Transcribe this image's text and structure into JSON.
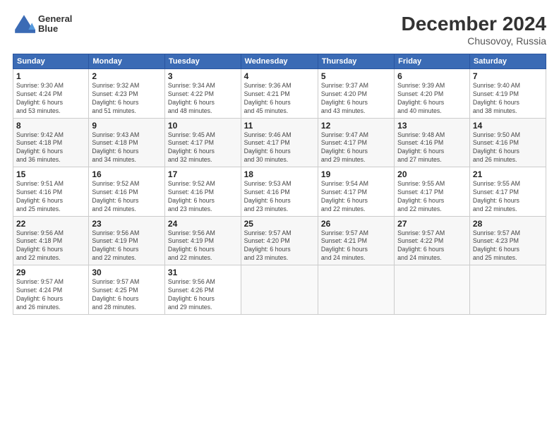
{
  "header": {
    "logo_line1": "General",
    "logo_line2": "Blue",
    "month_title": "December 2024",
    "location": "Chusovoy, Russia"
  },
  "weekdays": [
    "Sunday",
    "Monday",
    "Tuesday",
    "Wednesday",
    "Thursday",
    "Friday",
    "Saturday"
  ],
  "weeks": [
    [
      {
        "day": "1",
        "info": "Sunrise: 9:30 AM\nSunset: 4:24 PM\nDaylight: 6 hours\nand 53 minutes."
      },
      {
        "day": "2",
        "info": "Sunrise: 9:32 AM\nSunset: 4:23 PM\nDaylight: 6 hours\nand 51 minutes."
      },
      {
        "day": "3",
        "info": "Sunrise: 9:34 AM\nSunset: 4:22 PM\nDaylight: 6 hours\nand 48 minutes."
      },
      {
        "day": "4",
        "info": "Sunrise: 9:36 AM\nSunset: 4:21 PM\nDaylight: 6 hours\nand 45 minutes."
      },
      {
        "day": "5",
        "info": "Sunrise: 9:37 AM\nSunset: 4:20 PM\nDaylight: 6 hours\nand 43 minutes."
      },
      {
        "day": "6",
        "info": "Sunrise: 9:39 AM\nSunset: 4:20 PM\nDaylight: 6 hours\nand 40 minutes."
      },
      {
        "day": "7",
        "info": "Sunrise: 9:40 AM\nSunset: 4:19 PM\nDaylight: 6 hours\nand 38 minutes."
      }
    ],
    [
      {
        "day": "8",
        "info": "Sunrise: 9:42 AM\nSunset: 4:18 PM\nDaylight: 6 hours\nand 36 minutes."
      },
      {
        "day": "9",
        "info": "Sunrise: 9:43 AM\nSunset: 4:18 PM\nDaylight: 6 hours\nand 34 minutes."
      },
      {
        "day": "10",
        "info": "Sunrise: 9:45 AM\nSunset: 4:17 PM\nDaylight: 6 hours\nand 32 minutes."
      },
      {
        "day": "11",
        "info": "Sunrise: 9:46 AM\nSunset: 4:17 PM\nDaylight: 6 hours\nand 30 minutes."
      },
      {
        "day": "12",
        "info": "Sunrise: 9:47 AM\nSunset: 4:17 PM\nDaylight: 6 hours\nand 29 minutes."
      },
      {
        "day": "13",
        "info": "Sunrise: 9:48 AM\nSunset: 4:16 PM\nDaylight: 6 hours\nand 27 minutes."
      },
      {
        "day": "14",
        "info": "Sunrise: 9:50 AM\nSunset: 4:16 PM\nDaylight: 6 hours\nand 26 minutes."
      }
    ],
    [
      {
        "day": "15",
        "info": "Sunrise: 9:51 AM\nSunset: 4:16 PM\nDaylight: 6 hours\nand 25 minutes."
      },
      {
        "day": "16",
        "info": "Sunrise: 9:52 AM\nSunset: 4:16 PM\nDaylight: 6 hours\nand 24 minutes."
      },
      {
        "day": "17",
        "info": "Sunrise: 9:52 AM\nSunset: 4:16 PM\nDaylight: 6 hours\nand 23 minutes."
      },
      {
        "day": "18",
        "info": "Sunrise: 9:53 AM\nSunset: 4:16 PM\nDaylight: 6 hours\nand 23 minutes."
      },
      {
        "day": "19",
        "info": "Sunrise: 9:54 AM\nSunset: 4:17 PM\nDaylight: 6 hours\nand 22 minutes."
      },
      {
        "day": "20",
        "info": "Sunrise: 9:55 AM\nSunset: 4:17 PM\nDaylight: 6 hours\nand 22 minutes."
      },
      {
        "day": "21",
        "info": "Sunrise: 9:55 AM\nSunset: 4:17 PM\nDaylight: 6 hours\nand 22 minutes."
      }
    ],
    [
      {
        "day": "22",
        "info": "Sunrise: 9:56 AM\nSunset: 4:18 PM\nDaylight: 6 hours\nand 22 minutes."
      },
      {
        "day": "23",
        "info": "Sunrise: 9:56 AM\nSunset: 4:19 PM\nDaylight: 6 hours\nand 22 minutes."
      },
      {
        "day": "24",
        "info": "Sunrise: 9:56 AM\nSunset: 4:19 PM\nDaylight: 6 hours\nand 22 minutes."
      },
      {
        "day": "25",
        "info": "Sunrise: 9:57 AM\nSunset: 4:20 PM\nDaylight: 6 hours\nand 23 minutes."
      },
      {
        "day": "26",
        "info": "Sunrise: 9:57 AM\nSunset: 4:21 PM\nDaylight: 6 hours\nand 24 minutes."
      },
      {
        "day": "27",
        "info": "Sunrise: 9:57 AM\nSunset: 4:22 PM\nDaylight: 6 hours\nand 24 minutes."
      },
      {
        "day": "28",
        "info": "Sunrise: 9:57 AM\nSunset: 4:23 PM\nDaylight: 6 hours\nand 25 minutes."
      }
    ],
    [
      {
        "day": "29",
        "info": "Sunrise: 9:57 AM\nSunset: 4:24 PM\nDaylight: 6 hours\nand 26 minutes."
      },
      {
        "day": "30",
        "info": "Sunrise: 9:57 AM\nSunset: 4:25 PM\nDaylight: 6 hours\nand 28 minutes."
      },
      {
        "day": "31",
        "info": "Sunrise: 9:56 AM\nSunset: 4:26 PM\nDaylight: 6 hours\nand 29 minutes."
      },
      {
        "day": "",
        "info": ""
      },
      {
        "day": "",
        "info": ""
      },
      {
        "day": "",
        "info": ""
      },
      {
        "day": "",
        "info": ""
      }
    ]
  ]
}
